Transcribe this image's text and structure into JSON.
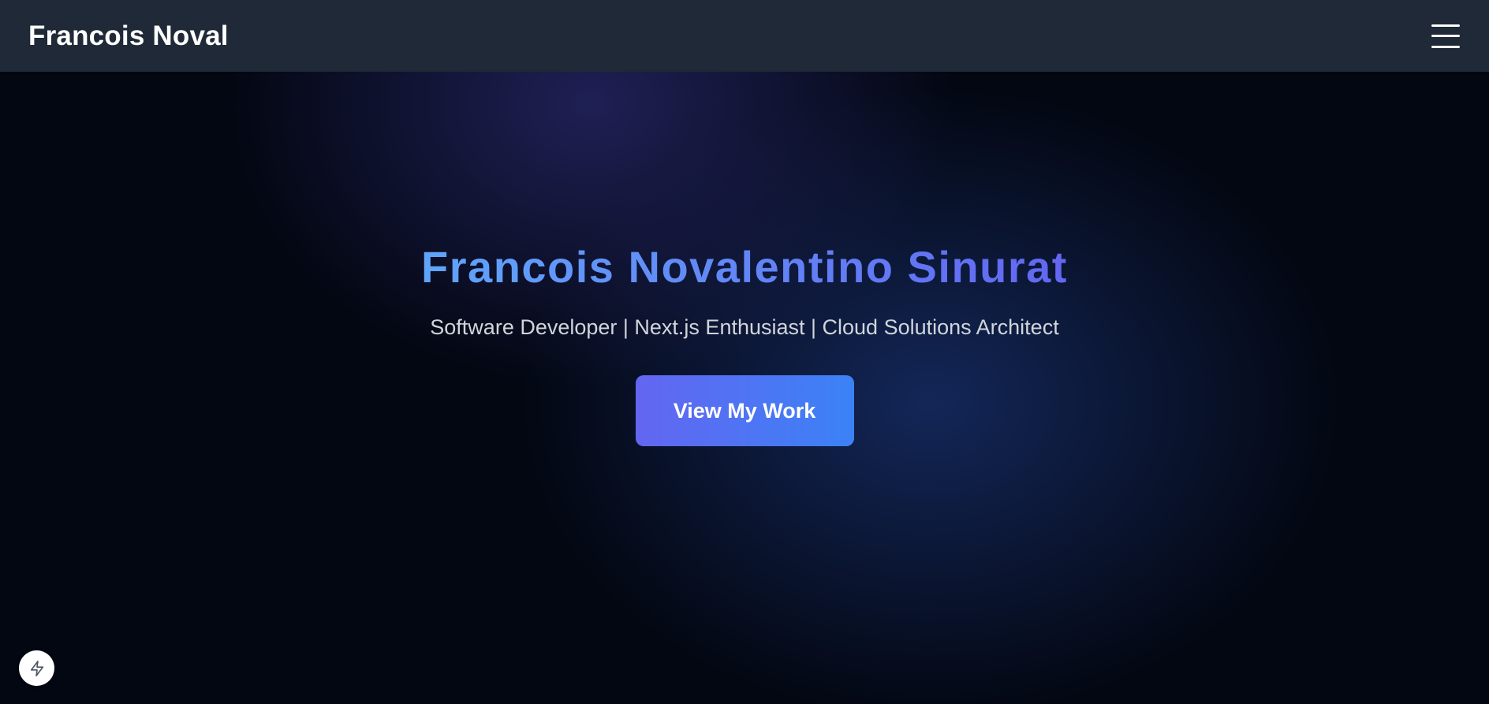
{
  "navbar": {
    "brand": "Francois Noval",
    "menu_icon": "hamburger-menu-icon"
  },
  "hero": {
    "title": "Francois Novalentino Sinurat",
    "subtitle": "Software Developer | Next.js Enthusiast | Cloud Solutions Architect",
    "cta_label": "View My Work",
    "title_gradient": [
      "#60a5fa",
      "#6366f1"
    ],
    "cta_gradient": [
      "#6366f1",
      "#3b82f6"
    ]
  },
  "badge": {
    "icon": "lightning-bolt-icon"
  },
  "colors": {
    "navbar_bg": "#1f2937",
    "page_bg": "#030712",
    "subtitle_text": "#d1d5db"
  }
}
